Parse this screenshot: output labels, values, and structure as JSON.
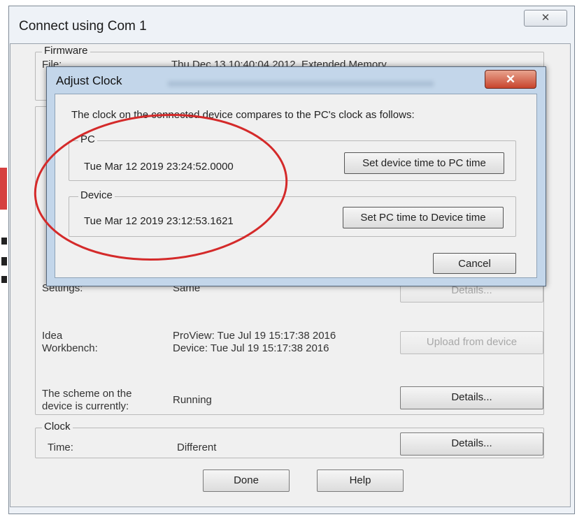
{
  "main_window": {
    "title": "Connect using Com 1",
    "close_glyph": "✕",
    "firmware": {
      "label": "Firmware",
      "file_label": "File:",
      "file_value": "Thu Dec 13 10:40:04 2012, Extended Memory"
    },
    "settings": {
      "label": "Settings:",
      "value": "Same",
      "button": "Details..."
    },
    "idea_workbench": {
      "label_line1": "Idea",
      "label_line2": "Workbench:",
      "value_line1": "ProView: Tue Jul 19 15:17:38 2016",
      "value_line2": "Device: Tue Jul 19 15:17:38 2016",
      "button": "Upload from device"
    },
    "scheme": {
      "label_line1": "The scheme on the",
      "label_line2": "device is currently:",
      "value": "Running",
      "button": "Details..."
    },
    "clock": {
      "label": "Clock",
      "time_label": "Time:",
      "time_value": "Different",
      "button": "Details..."
    },
    "done_button": "Done",
    "help_button": "Help"
  },
  "dialog": {
    "title": "Adjust Clock",
    "close_glyph": "✕",
    "message": "The clock on the connected device compares to the PC's clock as follows:",
    "pc": {
      "label": "PC",
      "time": "Tue Mar 12 2019 23:24:52.0000",
      "button": "Set device time to PC time"
    },
    "device": {
      "label": "Device",
      "time": "Tue Mar 12 2019 23:12:53.1621",
      "button": "Set PC time to Device time"
    },
    "cancel_button": "Cancel"
  },
  "colors": {
    "annotation_oval": "#d42a2a",
    "dialog_frame": "#c3d6ea",
    "close_button": "#c8442c",
    "window_background": "#f0f0f0"
  }
}
